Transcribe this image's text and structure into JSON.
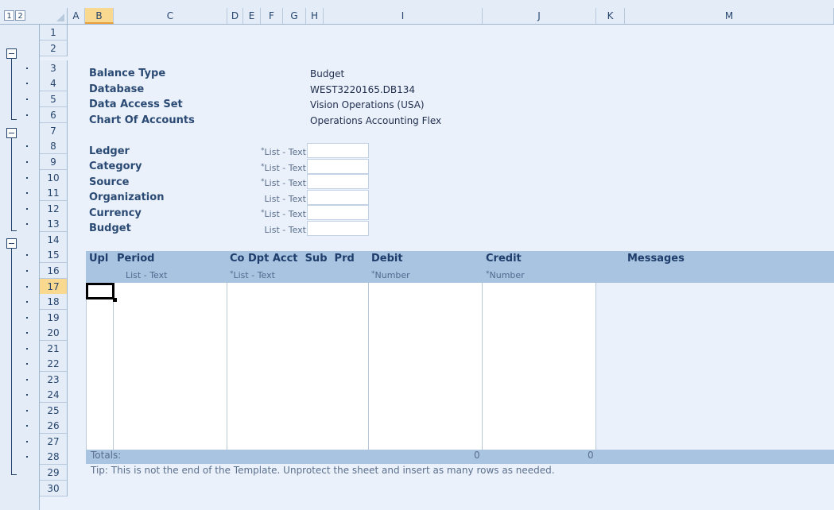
{
  "outline_levels": [
    "1",
    "2"
  ],
  "columns": [
    "A",
    "B",
    "C",
    "D",
    "E",
    "F",
    "G",
    "H",
    "I",
    "J",
    "K",
    "M"
  ],
  "selected_column": "B",
  "rows": [
    "1",
    "2",
    "3",
    "4",
    "5",
    "6",
    "7",
    "8",
    "9",
    "10",
    "11",
    "12",
    "13",
    "14",
    "15",
    "16",
    "17",
    "18",
    "19",
    "20",
    "21",
    "22",
    "23",
    "24",
    "25",
    "26",
    "27",
    "28",
    "29",
    "30"
  ],
  "selected_row": "17",
  "header_info": [
    {
      "label": "Balance Type",
      "value": "Budget"
    },
    {
      "label": "Database",
      "value": "WEST3220165.DB134"
    },
    {
      "label": "Data Access Set",
      "value": "Vision Operations (USA)"
    },
    {
      "label": "Chart Of Accounts",
      "value": "Operations Accounting Flex"
    }
  ],
  "params": [
    {
      "label": "Ledger",
      "required": "*",
      "hint": "List - Text"
    },
    {
      "label": "Category",
      "required": "*",
      "hint": "List - Text"
    },
    {
      "label": "Source",
      "required": "*",
      "hint": "List - Text"
    },
    {
      "label": "Organization",
      "required": "",
      "hint": "List - Text"
    },
    {
      "label": "Currency",
      "required": "*",
      "hint": "List - Text"
    },
    {
      "label": "Budget",
      "required": "",
      "hint": "List - Text"
    }
  ],
  "table_headers": {
    "upl": "Upl",
    "period": "Period",
    "segments": "Co Dpt Acct  Sub  Prd",
    "debit": "Debit",
    "credit": "Credit",
    "messages": "Messages"
  },
  "table_subheaders": {
    "period": "List - Text",
    "segments_star": "*",
    "segments": "List - Text",
    "debit_star": "*",
    "debit": "Number",
    "credit_star": "*",
    "credit": "Number"
  },
  "totals": {
    "label": "Totals:",
    "debit": "0",
    "credit": "0"
  },
  "tip": "Tip: This is not the end of the Template.  Unprotect the sheet and insert as many rows as needed."
}
